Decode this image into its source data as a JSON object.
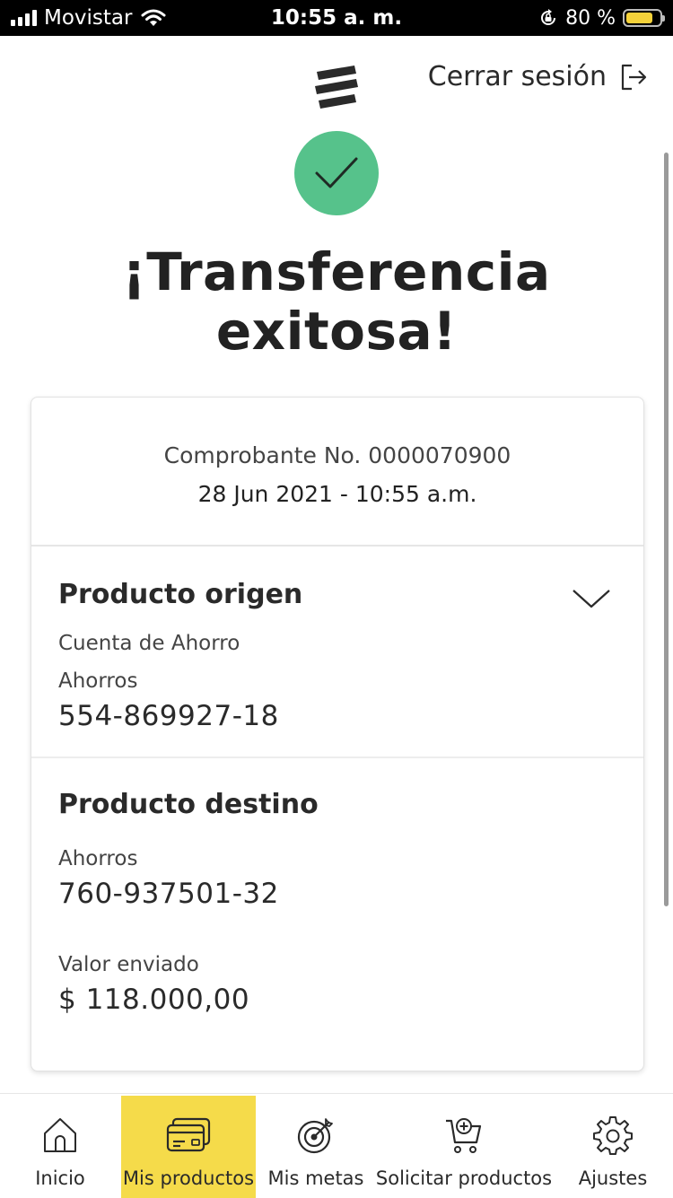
{
  "status_bar": {
    "carrier": "Movistar",
    "time": "10:55 a. m.",
    "battery_percent": "80 %",
    "battery_level": 0.8,
    "icons": [
      "signal-icon",
      "wifi-icon",
      "rotation-lock-icon",
      "battery-icon"
    ]
  },
  "header": {
    "logout_label": "Cerrar sesión",
    "logo_icon": "bank-logo-icon",
    "logout_icon": "logout-icon"
  },
  "success": {
    "icon": "check-icon",
    "icon_color": "#56c28b",
    "title_line1": "¡Transferencia",
    "title_line2": "exitosa!"
  },
  "receipt": {
    "number_text": "Comprobante No. 0000070900",
    "date_text": "28 Jun 2021 - 10:55 a.m."
  },
  "origin": {
    "title": "Producto origen",
    "product_name": "Cuenta de Ahorro",
    "account_type": "Ahorros",
    "account_number": "554-869927-18"
  },
  "destination": {
    "title": "Producto destino",
    "account_type": "Ahorros",
    "account_number": "760-937501-32",
    "amount_label": "Valor enviado",
    "amount": "$ 118.000,00"
  },
  "tabs": [
    {
      "label": "Inicio",
      "icon": "home-icon",
      "active": false
    },
    {
      "label": "Mis productos",
      "icon": "cards-icon",
      "active": true
    },
    {
      "label": "Mis metas",
      "icon": "target-icon",
      "active": false
    },
    {
      "label": "Solicitar productos",
      "icon": "cart-add-icon",
      "active": false
    },
    {
      "label": "Ajustes",
      "icon": "gear-icon",
      "active": false
    }
  ],
  "colors": {
    "accent": "#f5db4a",
    "success": "#56c28b",
    "battery": "#f5d23a"
  }
}
